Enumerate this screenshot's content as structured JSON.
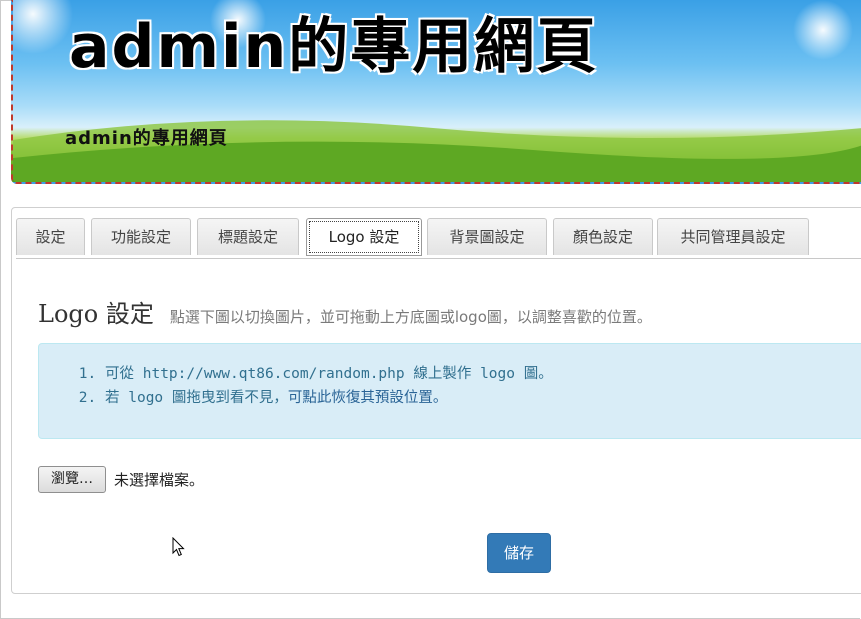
{
  "banner": {
    "title": "admin的專用網頁",
    "subtitle": "admin的專用網頁"
  },
  "tabs": [
    {
      "label": "設定",
      "active": false
    },
    {
      "label": "功能設定",
      "active": false
    },
    {
      "label": "標題設定",
      "active": false
    },
    {
      "label": "Logo 設定",
      "active": true
    },
    {
      "label": "背景圖設定",
      "active": false
    },
    {
      "label": "顏色設定",
      "active": false
    },
    {
      "label": "共同管理員設定",
      "active": false
    }
  ],
  "page": {
    "title": "Logo 設定",
    "description": "點選下圖以切換圖片，並可拖動上方底圖或logo圖，以調整喜歡的位置。"
  },
  "info": {
    "item1": "可從 http://www.qt86.com/random.php 線上製作 logo 圖。",
    "item2_prefix": "若 logo 圖拖曳到看不見，",
    "item2_link": "可點此恢復其預設位置。"
  },
  "file": {
    "button_label": "瀏覽…",
    "status": "未選擇檔案。"
  },
  "save_label": "儲存",
  "colors": {
    "primary": "#337ab7",
    "info_bg": "#d9edf7",
    "info_text": "#31708f",
    "banner_border": "#c0392b"
  },
  "icons": {
    "cursor": "mouse-pointer-icon"
  }
}
